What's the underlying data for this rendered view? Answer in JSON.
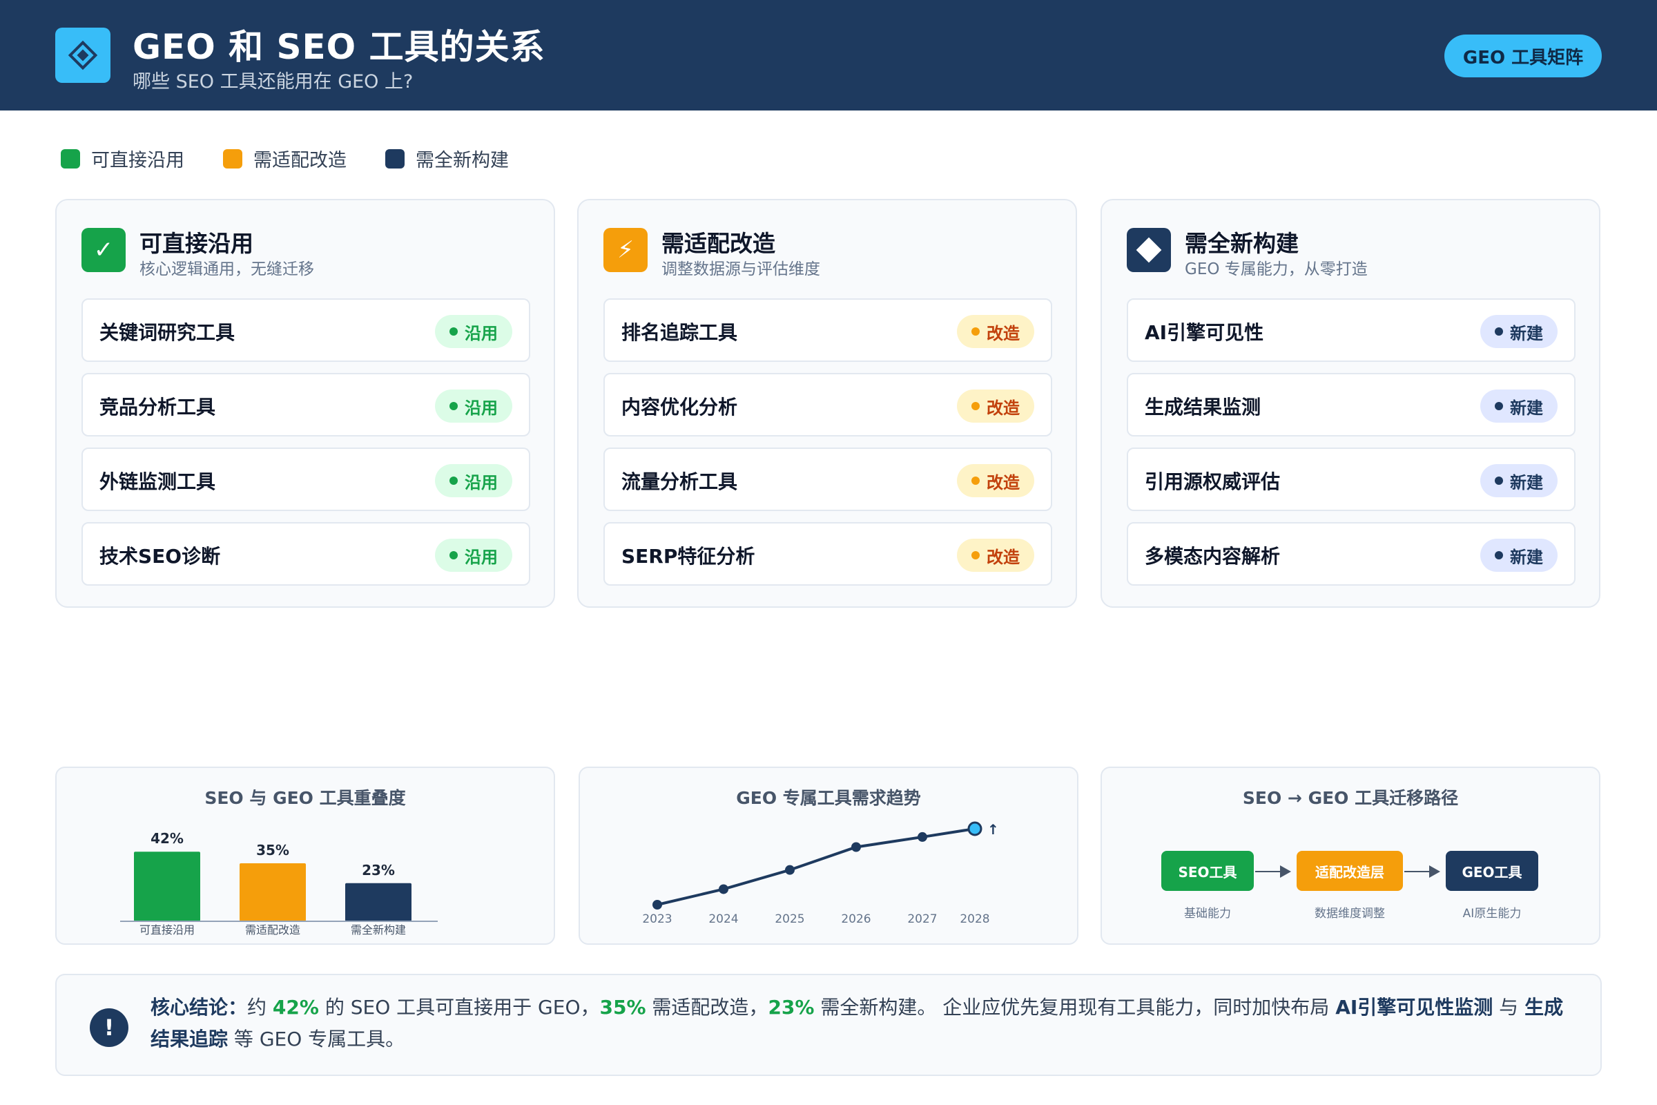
{
  "header": {
    "title": "GEO 和 SEO 工具的关系",
    "subtitle": "哪些 SEO 工具还能用在 GEO 上?",
    "button_label": "GEO 工具矩阵"
  },
  "legend": [
    {
      "label": "可直接沿用",
      "color": "#16a34a"
    },
    {
      "label": "需适配改造",
      "color": "#f59e0b"
    },
    {
      "label": "需全新构建",
      "color": "#1e3a5f"
    }
  ],
  "cards": [
    {
      "title": "可直接沿用",
      "subtitle": "核心逻辑通用，无缝迁移",
      "icon": "check-icon",
      "icon_glyph": "✓",
      "color": "#16a34a",
      "badge_bg": "#dcfce7",
      "badge_fg": "#16a34a",
      "tools": [
        {
          "name": "关键词研究工具",
          "badge": "沿用"
        },
        {
          "name": "竞品分析工具",
          "badge": "沿用"
        },
        {
          "name": "外链监测工具",
          "badge": "沿用"
        },
        {
          "name": "技术SEO诊断",
          "badge": "沿用"
        }
      ]
    },
    {
      "title": "需适配改造",
      "subtitle": "调整数据源与评估维度",
      "icon": "lightning-icon",
      "icon_glyph": "⚡",
      "color": "#f59e0b",
      "badge_bg": "#fef3c7",
      "badge_fg": "#c2410c",
      "tools": [
        {
          "name": "排名追踪工具",
          "badge": "改造"
        },
        {
          "name": "内容优化分析",
          "badge": "改造"
        },
        {
          "name": "流量分析工具",
          "badge": "改造"
        },
        {
          "name": "SERP特征分析",
          "badge": "改造"
        }
      ]
    },
    {
      "title": "需全新构建",
      "subtitle": "GEO 专属能力，从零打造",
      "icon": "diamond-icon",
      "icon_glyph": "",
      "color": "#1e3a5f",
      "badge_bg": "#e0e7ff",
      "badge_fg": "#1e3a5f",
      "tools": [
        {
          "name": "AI引擎可见性",
          "badge": "新建"
        },
        {
          "name": "生成结果监测",
          "badge": "新建"
        },
        {
          "name": "引用源权威评估",
          "badge": "新建"
        },
        {
          "name": "多模态内容解析",
          "badge": "新建"
        }
      ]
    }
  ],
  "panels": {
    "overlap_title": "SEO 与 GEO 工具重叠度",
    "trend_title": "GEO 专属工具需求趋势",
    "migration_title": "SEO → GEO 工具迁移路径"
  },
  "chart_data": [
    {
      "type": "bar",
      "title": "SEO 与 GEO 工具重叠度",
      "categories": [
        "可直接沿用",
        "需适配改造",
        "需全新构建"
      ],
      "values": [
        42,
        35,
        23
      ],
      "value_labels": [
        "42%",
        "35%",
        "23%"
      ],
      "colors": [
        "#16a34a",
        "#f59e0b",
        "#1e3a5f"
      ],
      "ylim": [
        0,
        50
      ]
    },
    {
      "type": "line",
      "title": "GEO 专属工具需求趋势",
      "x": [
        "2023",
        "2024",
        "2025",
        "2026",
        "2027",
        "2028"
      ],
      "values": [
        10,
        27,
        48,
        73,
        84,
        93
      ],
      "end_marker": "↑",
      "ylim": [
        0,
        100
      ]
    }
  ],
  "migration": {
    "steps": [
      {
        "label": "SEO工具",
        "caption": "基础能力",
        "color": "#16a34a"
      },
      {
        "label": "适配改造层",
        "caption": "数据维度调整",
        "color": "#f59e0b"
      },
      {
        "label": "GEO工具",
        "caption": "AI原生能力",
        "color": "#1e3a5f"
      }
    ]
  },
  "conclusion": {
    "icon": "exclamation-icon",
    "icon_glyph": "!",
    "lead": "核心结论：",
    "t1": "约 ",
    "p1": "42%",
    "t2": " 的 SEO 工具可直接用于 GEO，",
    "p2": "35%",
    "t3": " 需适配改造，",
    "p3": "23%",
    "t4": " 需全新构建。 企业应优先复用现有工具能力，同时加快布局 ",
    "k1": "AI引擎可见性监测",
    "t5": " 与 ",
    "k2": "生成结果追踪",
    "t6": " 等 GEO 专属工具。"
  }
}
